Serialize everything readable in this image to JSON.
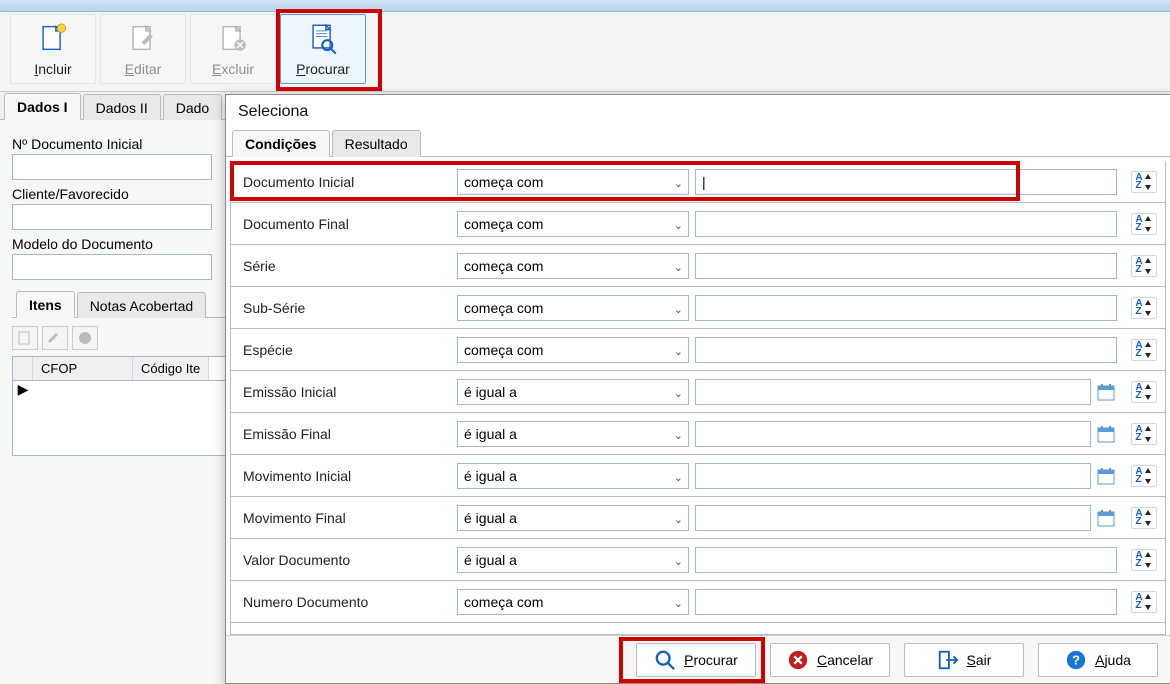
{
  "toolbar": {
    "incluir": "Incluir",
    "editar": "Editar",
    "excluir": "Excluir",
    "procurar": "Procurar"
  },
  "bg": {
    "tabs": [
      "Dados I",
      "Dados II",
      "Dado"
    ],
    "label_doc_inicial": "Nº Documento Inicial",
    "label_cliente": "Cliente/Favorecido",
    "label_modelo": "Modelo do Documento",
    "sub_tabs": [
      "Itens",
      "Notas Acobertad"
    ],
    "grid_cols": [
      "CFOP",
      "Código Ite"
    ]
  },
  "dialog": {
    "title": "Seleciona",
    "tabs": [
      "Condições",
      "Resultado"
    ],
    "filters": [
      {
        "name": "Documento Inicial",
        "op": "começa com",
        "has_cal": false,
        "value": "|"
      },
      {
        "name": "Documento Final",
        "op": "começa com",
        "has_cal": false,
        "value": ""
      },
      {
        "name": "Série",
        "op": "começa com",
        "has_cal": false,
        "value": ""
      },
      {
        "name": "Sub-Série",
        "op": "começa com",
        "has_cal": false,
        "value": ""
      },
      {
        "name": "Espécie",
        "op": "começa com",
        "has_cal": false,
        "value": ""
      },
      {
        "name": "Emissão Inicial",
        "op": "é igual a",
        "has_cal": true,
        "value": ""
      },
      {
        "name": "Emissão Final",
        "op": "é igual a",
        "has_cal": true,
        "value": ""
      },
      {
        "name": "Movimento Inicial",
        "op": "é igual a",
        "has_cal": true,
        "value": ""
      },
      {
        "name": "Movimento Final",
        "op": "é igual a",
        "has_cal": true,
        "value": ""
      },
      {
        "name": "Valor Documento",
        "op": "é igual a",
        "has_cal": false,
        "value": ""
      },
      {
        "name": "Numero Documento",
        "op": "começa com",
        "has_cal": false,
        "value": ""
      }
    ],
    "buttons": {
      "procurar": "Procurar",
      "cancelar": "Cancelar",
      "sair": "Sair",
      "ajuda": "Ajuda"
    }
  }
}
